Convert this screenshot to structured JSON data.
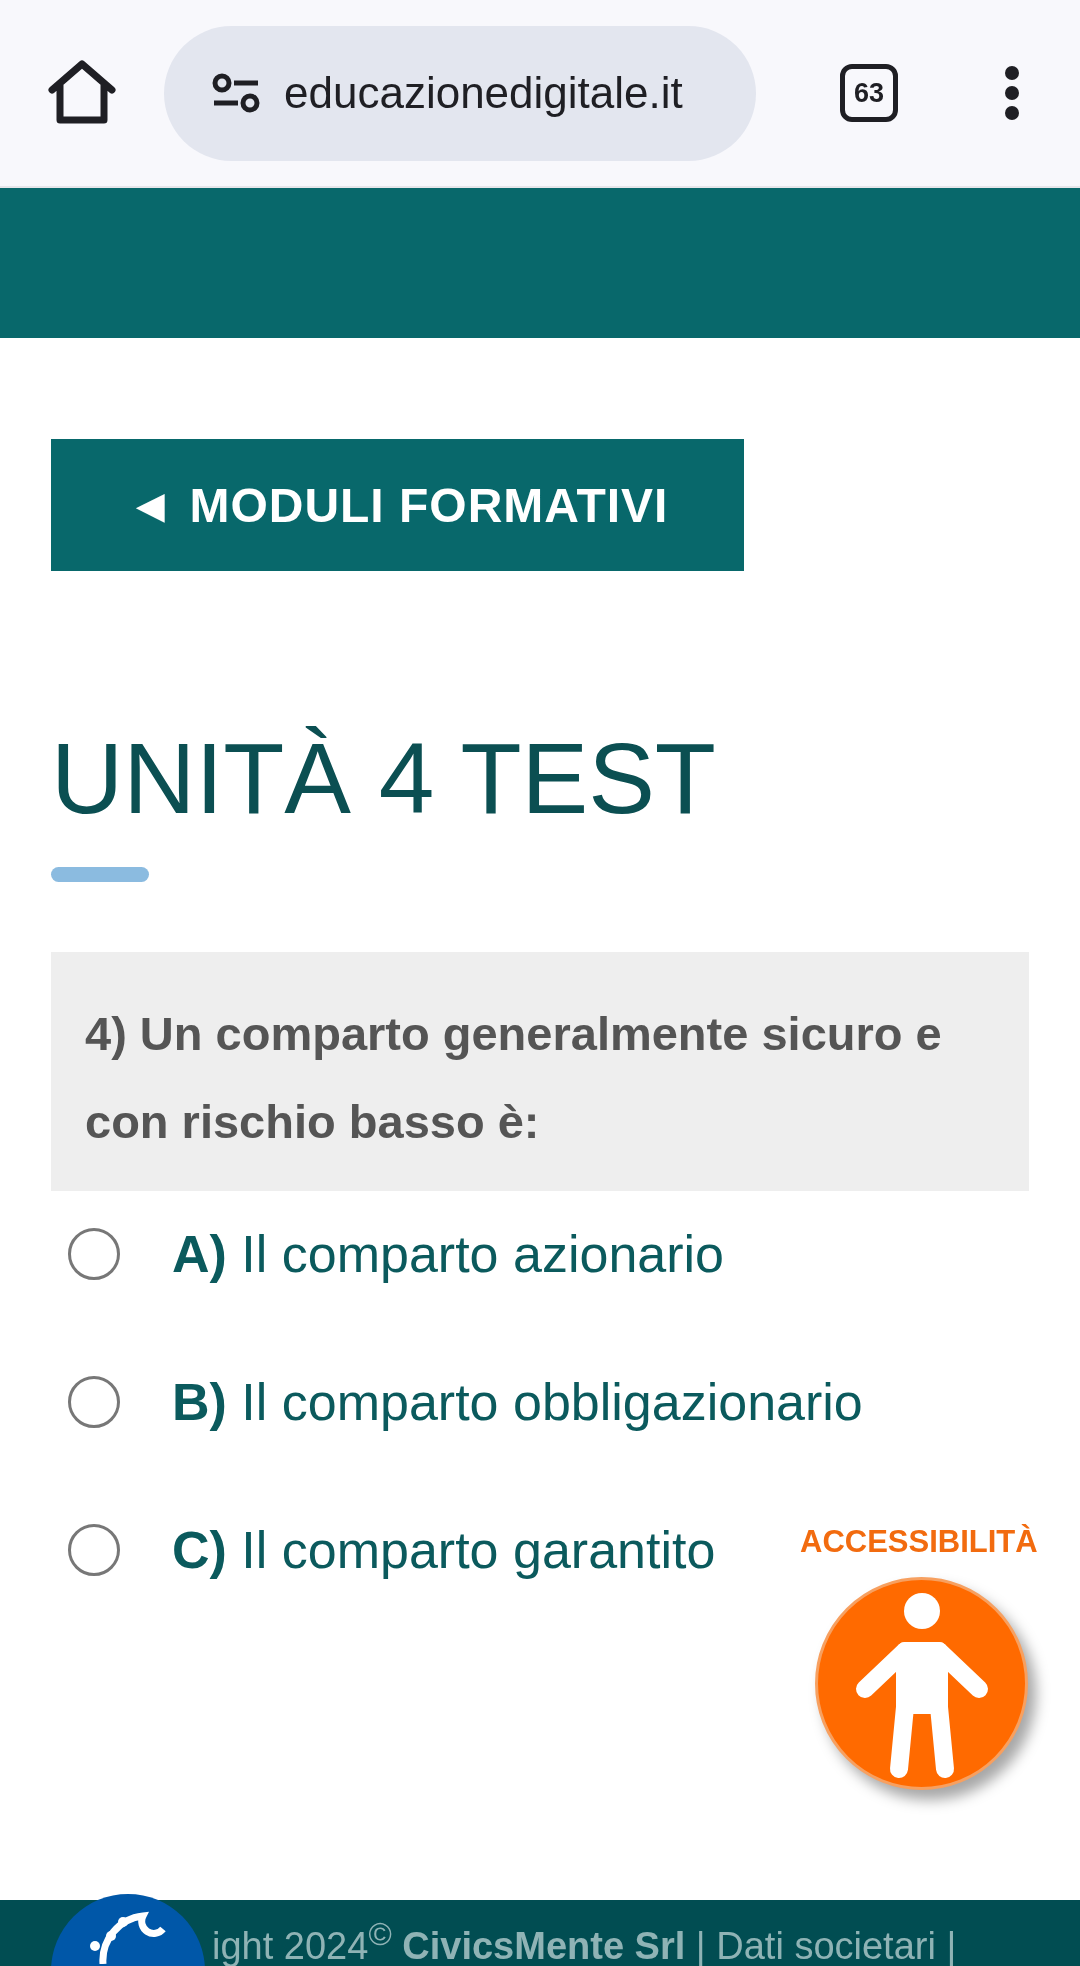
{
  "browser": {
    "url": "educazionedigitale.it",
    "tab_count": "63"
  },
  "back_button": {
    "label": "◄ MODULI FORMATIVI"
  },
  "title": "UNITÀ 4 TEST",
  "question": "4) Un comparto generalmente sicuro e con rischio basso è:",
  "options": [
    {
      "letter": "A)",
      "text": "Il comparto azionario",
      "selected": false
    },
    {
      "letter": "B)",
      "text": "Il comparto obbligazionario",
      "selected": false
    },
    {
      "letter": "C)",
      "text": "Il comparto garantito",
      "selected": false
    }
  ],
  "accessibility": {
    "label": "ACCESSIBILITÀ"
  },
  "footer": {
    "text": "ight 2024$^{©}$ **CivicsMente Srl** | Dati societari |"
  }
}
